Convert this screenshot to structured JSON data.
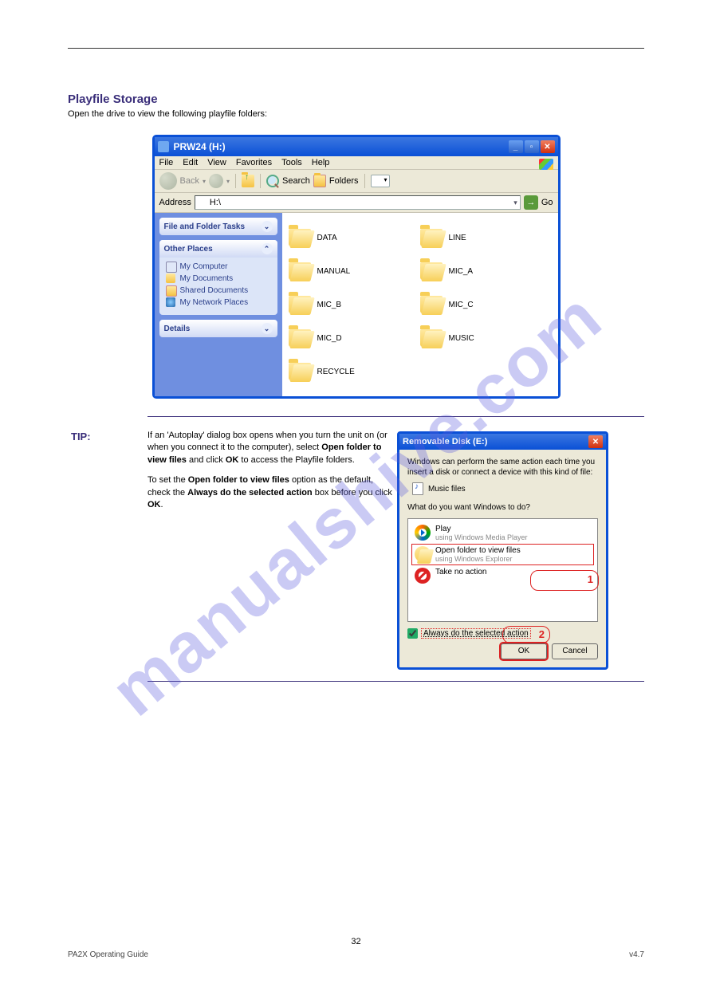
{
  "page": {
    "heading": "Playfile Storage",
    "subtext": "Open the drive to view the following playfile folders:",
    "tip_label": "TIP:",
    "tip_text_a": "If an 'Autoplay' dialog box opens when you turn the unit on (or when you connect it to the computer), select ",
    "tip_openfolder": "Open folder to view files",
    "tip_text_b": " and click ",
    "tip_ok": "OK",
    "tip_text_c": " to access the Playfile folders.",
    "tip_always_a": "To set the ",
    "tip_always_b": " option as the default, check the ",
    "tip_always_label": "Always do the selected action",
    "tip_text_d": " box before you click ",
    "tip_text_e": ".",
    "step1_num": "1",
    "step2_num": "2",
    "footer_left": "PA2X Operating Guide",
    "footer_right": "v4.7",
    "pagenum": "32"
  },
  "explorer": {
    "title": "PRW24 (H:)",
    "menu": [
      "File",
      "Edit",
      "View",
      "Favorites",
      "Tools",
      "Help"
    ],
    "back": "Back",
    "search": "Search",
    "folders_btn": "Folders",
    "address_label": "Address",
    "address_value": "H:\\",
    "go": "Go",
    "task_panel": "File and Folder Tasks",
    "other_panel": "Other Places",
    "details_panel": "Details",
    "other_links": {
      "pc": "My Computer",
      "docs": "My Documents",
      "shared": "Shared Documents",
      "net": "My Network Places"
    },
    "folders": [
      "DATA",
      "LINE",
      "MANUAL",
      "MIC_A",
      "MIC_B",
      "MIC_C",
      "MIC_D",
      "MUSIC",
      "RECYCLE"
    ]
  },
  "dialog": {
    "title": "Removable Disk (E:)",
    "intro": "Windows can perform the same action each time you insert a disk or connect a device with this kind of file:",
    "filetype": "Music files",
    "prompt": "What do you want Windows to do?",
    "play_t": "Play",
    "play_s": "using Windows Media Player",
    "open_t": "Open folder to view files",
    "open_s": "using Windows Explorer",
    "none_t": "Take no action",
    "always": "Always do the selected action",
    "ok": "OK",
    "cancel": "Cancel"
  },
  "watermark": "manualshive.com"
}
